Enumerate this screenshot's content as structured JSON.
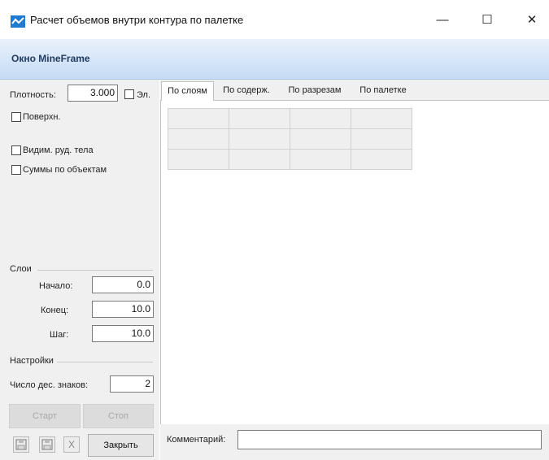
{
  "window": {
    "title": "Расчет объемов внутри контура по палетке",
    "minimize_glyph": "—",
    "maximize_glyph": "☐",
    "close_glyph": "✕"
  },
  "header": {
    "title": "Окно MineFrame"
  },
  "left": {
    "density_label": "Плотность:",
    "density_value": "3.000",
    "el_label": "Эл.",
    "surface_label": "Поверхн.",
    "visible_ore_label": "Видим. руд. тела",
    "sums_label": "Суммы по объектам",
    "layers_group": "Слои",
    "start_label": "Начало:",
    "start_value": "0.0",
    "end_label": "Конец:",
    "end_value": "10.0",
    "step_label": "Шаг:",
    "step_value": "10.0",
    "settings_group": "Настройки",
    "decimals_label": "Число дес. знаков:",
    "decimals_value": "2",
    "start_button": "Старт",
    "stop_button": "Стоп",
    "close_button": "Закрыть",
    "excel_glyph": "X"
  },
  "tabs": [
    "По слоям",
    "По содерж.",
    "По разрезам",
    "По палетке"
  ],
  "bottom": {
    "comment_label": "Комментарий:",
    "comment_value": ""
  }
}
